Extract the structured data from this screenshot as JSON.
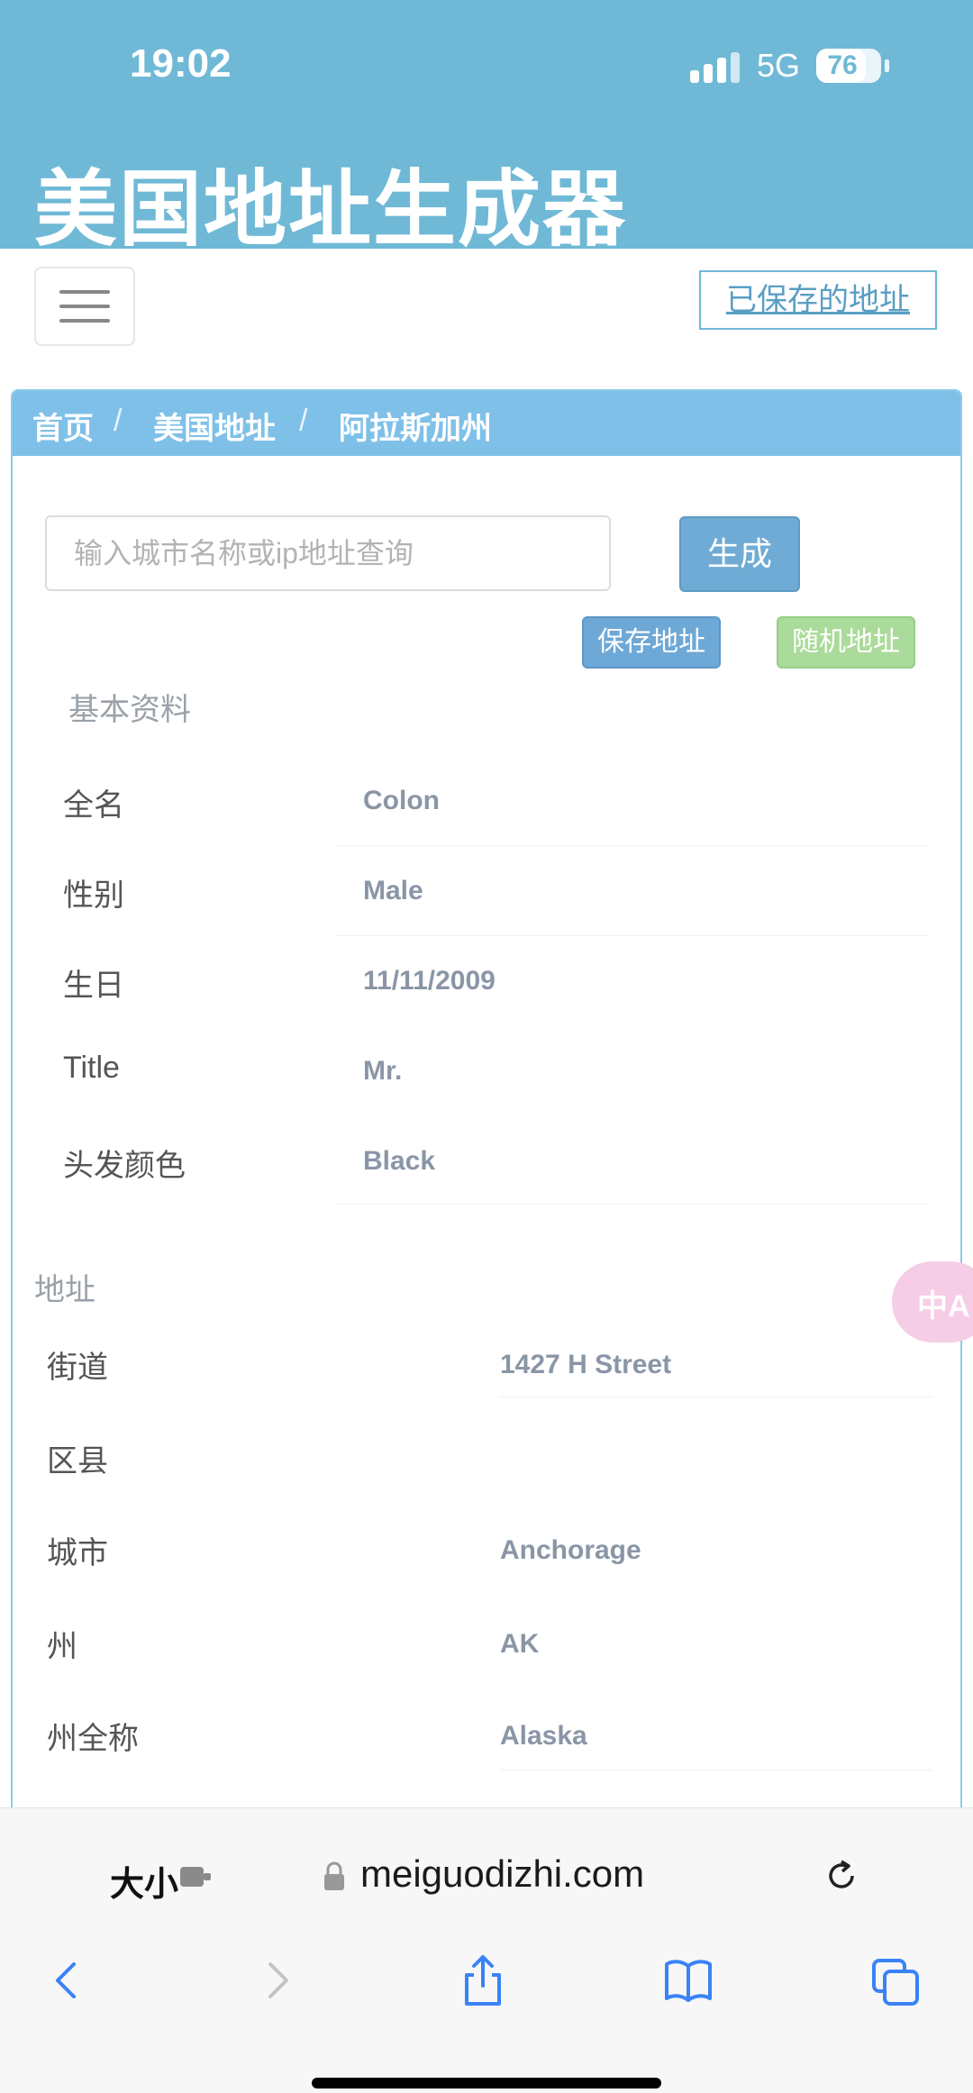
{
  "status_bar": {
    "time": "19:02",
    "network": "5G",
    "battery_percent": 76
  },
  "site": {
    "title": "美国地址生成器"
  },
  "nav": {
    "saved_addresses": "已保存的地址"
  },
  "breadcrumb": {
    "items": [
      "首页",
      "美国地址",
      "阿拉斯加州"
    ],
    "separator": "/"
  },
  "search": {
    "placeholder": "输入城市名称或ip地址查询",
    "value": "",
    "generate_label": "生成"
  },
  "actions": {
    "save_label": "保存地址",
    "random_label": "随机地址"
  },
  "basic_info": {
    "title": "基本资料",
    "rows": [
      {
        "label": "全名",
        "value": "Colon"
      },
      {
        "label": "性别",
        "value": "Male"
      },
      {
        "label": "生日",
        "value": "11/11/2009"
      },
      {
        "label": "Title",
        "value": "Mr."
      },
      {
        "label": "头发颜色",
        "value": "Black"
      }
    ]
  },
  "address": {
    "title": "地址",
    "rows": [
      {
        "label": "街道",
        "value": "1427 H Street"
      },
      {
        "label": "区县",
        "value": ""
      },
      {
        "label": "城市",
        "value": "Anchorage"
      },
      {
        "label": "州",
        "value": "AK"
      },
      {
        "label": "州全称",
        "value": "Alaska"
      }
    ]
  },
  "floating": {
    "translate_icon": "translate-icon",
    "translate_glyph": "中A"
  },
  "browser": {
    "text_size_label": "大小",
    "url": "meiguodizhi.com"
  },
  "colors": {
    "header": "#6fb9d6",
    "breadcrumb": "#7fc0e8",
    "generate": "#6fabd4",
    "save": "#6ea8d6",
    "random": "#aadb9a"
  }
}
